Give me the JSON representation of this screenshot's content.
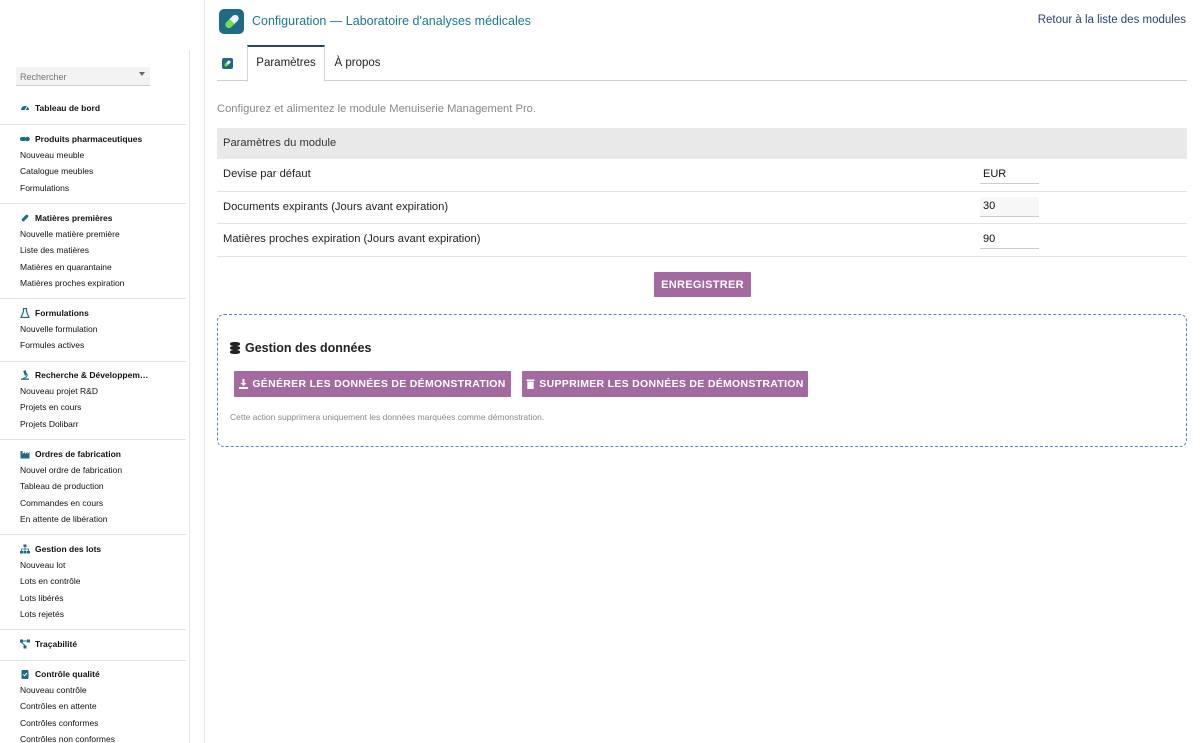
{
  "header": {
    "title": "Configuration — Laboratoire d'analyses médicales",
    "back_link": "Retour à la liste des modules"
  },
  "sidebar": {
    "search_placeholder": "Rechercher",
    "sections": [
      {
        "title": "Tableau de bord",
        "icon": "dashboard-icon",
        "items": []
      },
      {
        "title": "Produits pharmaceutiques",
        "icon": "pills-icon",
        "items": [
          "Nouveau meuble",
          "Catalogue meubles",
          "Formulations"
        ]
      },
      {
        "title": "Matières premières",
        "icon": "capsule-icon",
        "items": [
          "Nouvelle matière première",
          "Liste des matières",
          "Matières en quarantaine",
          "Matières proches expiration"
        ]
      },
      {
        "title": "Formulations",
        "icon": "flask-icon",
        "items": [
          "Nouvelle formulation",
          "Formules actives"
        ]
      },
      {
        "title": "Recherche & Développem…",
        "icon": "microscope-icon",
        "items": [
          "Nouveau projet R&D",
          "Projets en cours",
          "Projets Dolibarr"
        ]
      },
      {
        "title": "Ordres de fabrication",
        "icon": "industry-icon",
        "items": [
          "Nouvel ordre de fabrication",
          "Tableau de production",
          "Commandes en cours",
          "En attente de libération"
        ]
      },
      {
        "title": "Gestion des lots",
        "icon": "sitemap-icon",
        "items": [
          "Nouveau lot",
          "Lots en contrôle",
          "Lots libérés",
          "Lots rejetés"
        ]
      },
      {
        "title": "Traçabilité",
        "icon": "project-diagram-icon",
        "items": []
      },
      {
        "title": "Contrôle qualité",
        "icon": "clipboard-check-icon",
        "items": [
          "Nouveau contrôle",
          "Contrôles en attente",
          "Contrôles conformes",
          "Contrôles non conformes"
        ]
      }
    ]
  },
  "tabs": [
    {
      "label": "Paramètres",
      "active": true
    },
    {
      "label": "À propos",
      "active": false
    }
  ],
  "intro": "Configurez et alimentez le module Menuiserie Management Pro.",
  "settings": {
    "header": "Paramètres du module",
    "rows": [
      {
        "label": "Devise par défaut",
        "value": "EUR"
      },
      {
        "label": "Documents expirants (Jours avant expiration)",
        "value": "30"
      },
      {
        "label": "Matières proches expiration (Jours avant expiration)",
        "value": "90"
      }
    ],
    "save_label": "ENREGISTRER"
  },
  "data_management": {
    "title": "Gestion des données",
    "generate_label": "GÉNÉRER LES DONNÉES DE DÉMONSTRATION",
    "delete_label": "SUPPRIMER LES DONNÉES DE DÉMONSTRATION",
    "note": "Cette action supprimera uniquement les données marquées comme démonstration."
  },
  "colors": {
    "accent": "#a26a9e",
    "title": "#1b7a8f",
    "link": "#26466b",
    "icon_blue": "#1f6b86",
    "dashed_border": "#5b84c4"
  }
}
